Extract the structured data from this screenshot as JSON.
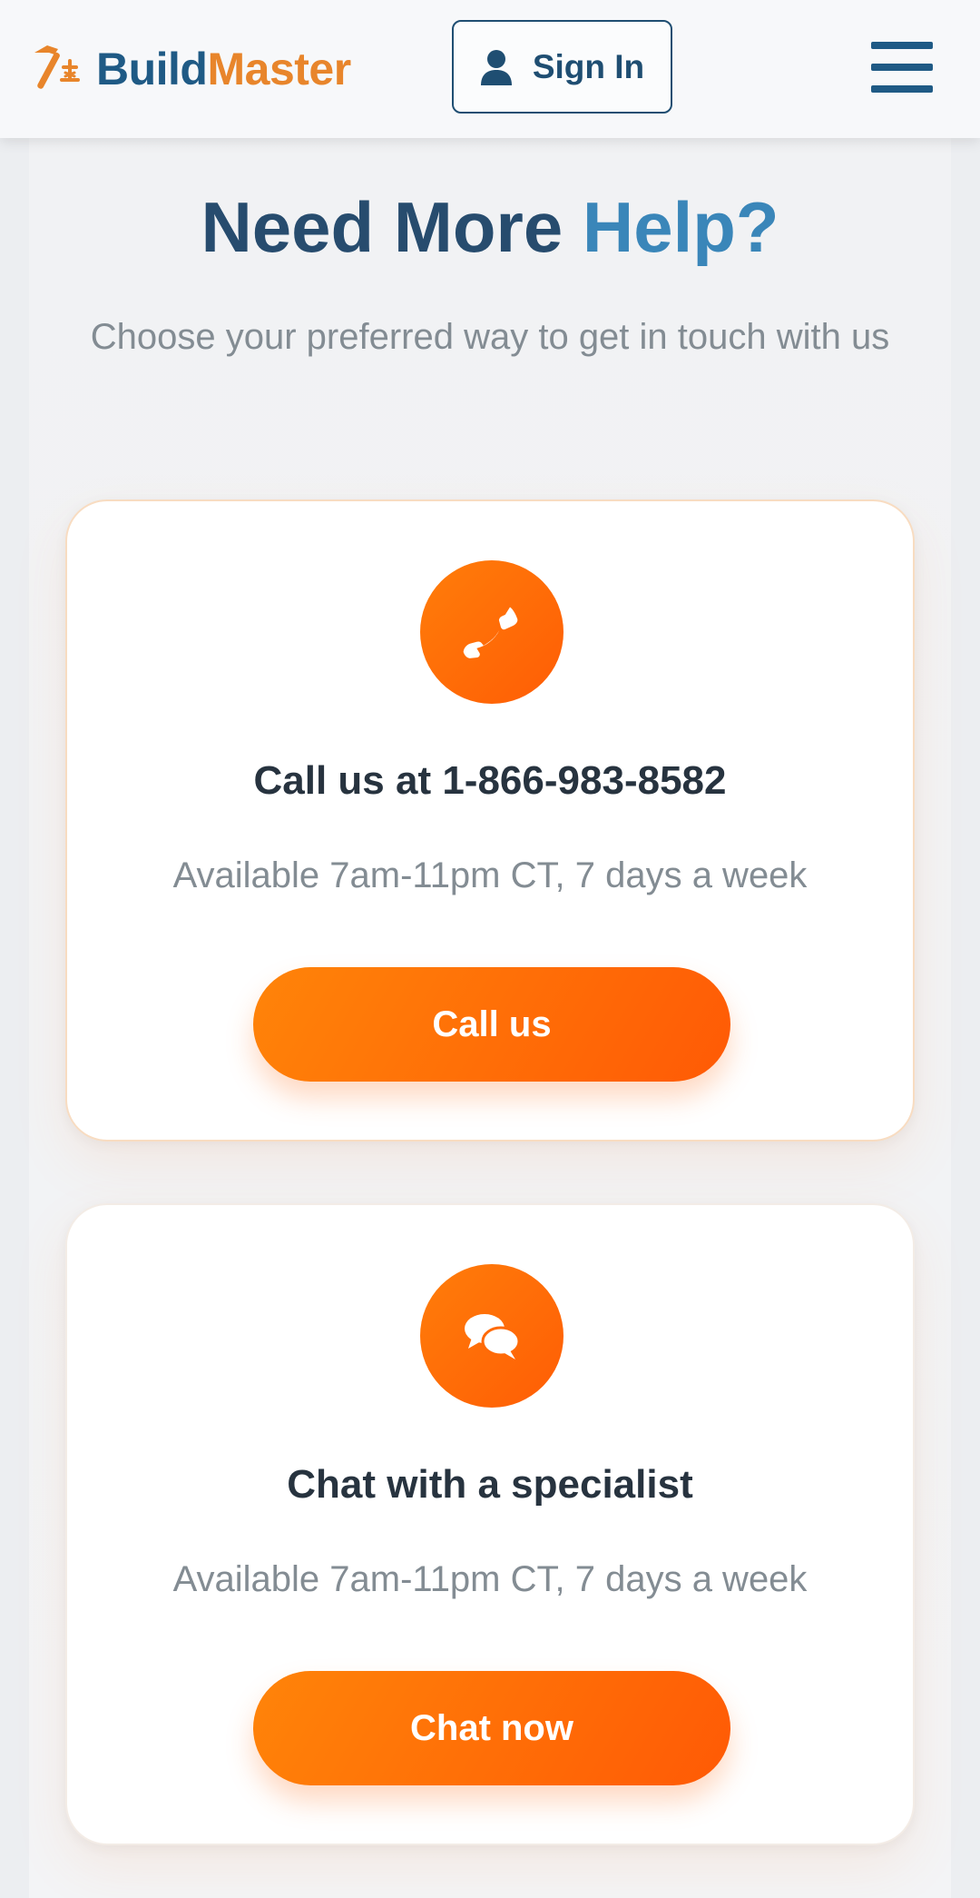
{
  "header": {
    "logo_part1": "Build",
    "logo_part2": "Master",
    "signin_label": "Sign In",
    "icons": {
      "logo": "hammer-tools-icon",
      "signin": "user-icon",
      "menu": "hamburger-menu-icon"
    }
  },
  "main": {
    "title_part1": "Need More",
    "title_part2": "Help?",
    "subtitle": "Choose your preferred way to get in touch with us"
  },
  "cards": [
    {
      "icon": "phone-icon",
      "title": "Call us at 1-866-983-8582",
      "availability": "Available 7am-11pm CT, 7 days a week",
      "button_label": "Call us"
    },
    {
      "icon": "chat-bubbles-icon",
      "title": "Chat with a specialist",
      "availability": "Available 7am-11pm CT, 7 days a week",
      "button_label": "Chat now"
    }
  ],
  "colors": {
    "brand_blue": "#1f5a85",
    "brand_orange": "#e8852b",
    "accent_orange": "#ff6a07",
    "text_dark": "#27333f",
    "text_muted": "#838c93"
  }
}
